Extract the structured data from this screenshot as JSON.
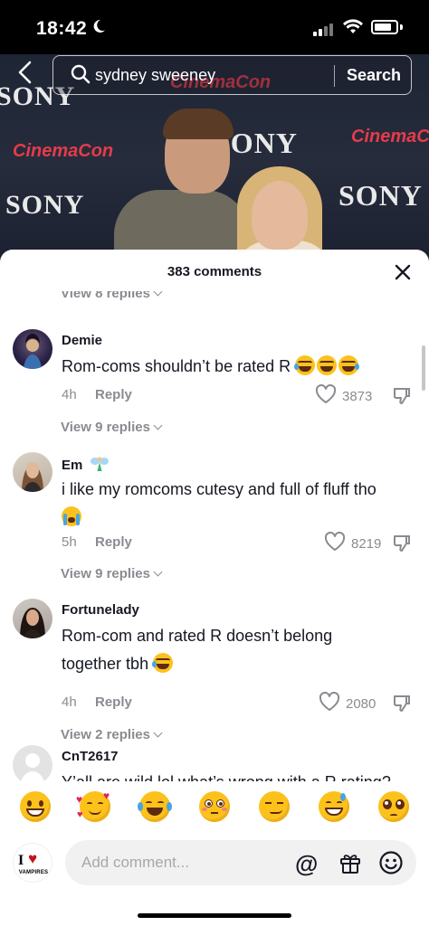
{
  "status_bar": {
    "time": "18:42"
  },
  "search": {
    "query": "sydney sweeney",
    "button_label": "Search"
  },
  "video": {
    "backdrop_words": [
      "SONY",
      "CinemaCon",
      "SONY",
      "CinemaCon",
      "SONY",
      "CinemaCon",
      "SONY"
    ]
  },
  "sheet": {
    "title": "383 comments"
  },
  "top_view_replies": "View 8 replies",
  "comments": [
    {
      "username": "Demie",
      "text": "Rom-coms shouldn’t be rated R",
      "emoji": [
        "face-with-tears-of-joy",
        "face-with-tears-of-joy",
        "face-with-tears-of-joy"
      ],
      "time": "4h",
      "reply_label": "Reply",
      "likes": "3873",
      "view_replies": "View 9 replies"
    },
    {
      "username": "Em",
      "username_emoji": "fairy",
      "text": "i like my romcoms cutesy and full of fluff tho",
      "emoji": [
        "loudly-crying-face"
      ],
      "time": "5h",
      "reply_label": "Reply",
      "likes": "8219",
      "view_replies": "View 9 replies"
    },
    {
      "username": "Fortunelady",
      "text": "Rom-com and rated R doesn’t belong together tbh",
      "emoji": [
        "face-with-tears-of-joy"
      ],
      "time": "4h",
      "reply_label": "Reply",
      "likes": "2080",
      "view_replies": "View 2 replies"
    },
    {
      "username": "CnT2617",
      "text": "Y’all are wild lol what’s wrong with a R rating?"
    }
  ],
  "emoji_bar": [
    "grinning-face",
    "smiling-face-with-hearts",
    "face-with-tears-of-joy",
    "flushed-face",
    "smirking-face",
    "grinning-face-with-sweat",
    "pleading-face"
  ],
  "input": {
    "placeholder": "Add comment...",
    "avatar_text_top": "I",
    "avatar_text_bottom": "VAMPIRES"
  },
  "icons": [
    "back-arrow-icon",
    "search-icon",
    "close-icon",
    "heart-icon",
    "dislike-icon",
    "at-icon",
    "gift-icon",
    "emoji-icon"
  ]
}
